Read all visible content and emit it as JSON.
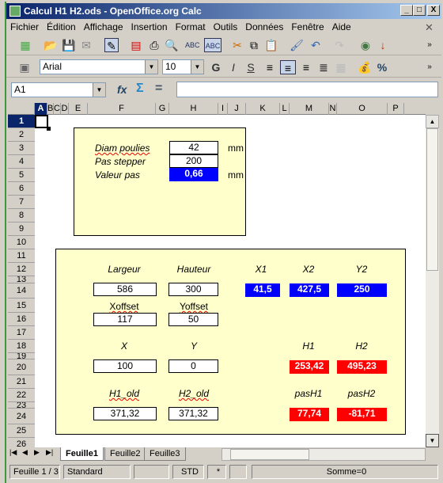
{
  "window": {
    "title": "Calcul H1 H2.ods - OpenOffice.org Calc",
    "minimize": "_",
    "maximize": "□",
    "close": "X"
  },
  "menu": [
    "Fichier",
    "Édition",
    "Affichage",
    "Insertion",
    "Format",
    "Outils",
    "Données",
    "Fenêtre",
    "Aide"
  ],
  "menu_close": "✕",
  "formatting": {
    "font": "Arial",
    "size": "10",
    "bold": "G",
    "italic": "I",
    "underline": "S",
    "percent": "%"
  },
  "formula_bar": {
    "cell_ref": "A1",
    "fx": "fx",
    "sum": "Σ",
    "equals": "=",
    "content": ""
  },
  "columns": [
    "A",
    "B",
    "C",
    "D",
    "E",
    "F",
    "G",
    "H",
    "I",
    "J",
    "K",
    "L",
    "M",
    "N",
    "O",
    "P"
  ],
  "rows": [
    "1",
    "2",
    "3",
    "4",
    "5",
    "6",
    "7",
    "8",
    "9",
    "10",
    "11",
    "12",
    "13",
    "14",
    "15",
    "16",
    "17",
    "18",
    "19",
    "20",
    "21",
    "22",
    "23",
    "24",
    "25",
    "26"
  ],
  "params": {
    "diam_label": "Diam poulies",
    "diam_value": "42",
    "diam_unit": "mm",
    "pas_label": "Pas stepper",
    "pas_value": "200",
    "valeur_label": "Valeur pas",
    "valeur_value": "0,66",
    "valeur_unit": "mm"
  },
  "calc": {
    "largeur_label": "Largeur",
    "largeur": "586",
    "hauteur_label": "Hauteur",
    "hauteur": "300",
    "xoffset_label": "Xoffset",
    "xoffset": "117",
    "yoffset_label": "Yoffset",
    "yoffset": "50",
    "x1_label": "X1",
    "x1": "41,5",
    "x2_label": "X2",
    "x2": "427,5",
    "y2_label": "Y2",
    "y2": "250",
    "x_label": "X",
    "x": "100",
    "y_label": "Y",
    "y": "0",
    "h1_label": "H1",
    "h1": "253,42",
    "h2_label": "H2",
    "h2": "495,23",
    "h1old_label": "H1_old",
    "h1old": "371,32",
    "h2old_label": "H2_old",
    "h2old": "371,32",
    "pash1_label": "pasH1",
    "pash1": "77,74",
    "pash2_label": "pasH2",
    "pash2": "-81,71"
  },
  "sheets": [
    "Feuille1",
    "Feuille2",
    "Feuille3"
  ],
  "status": {
    "sheet": "Feuille 1 / 3",
    "style": "Standard",
    "mode": "STD",
    "modified": "*",
    "sum": "Somme=0"
  },
  "colors": {
    "input_bg": "#ffffff",
    "computed_blue": "#0000ff",
    "computed_red": "#ff0000",
    "box_bg": "#ffffcc"
  }
}
